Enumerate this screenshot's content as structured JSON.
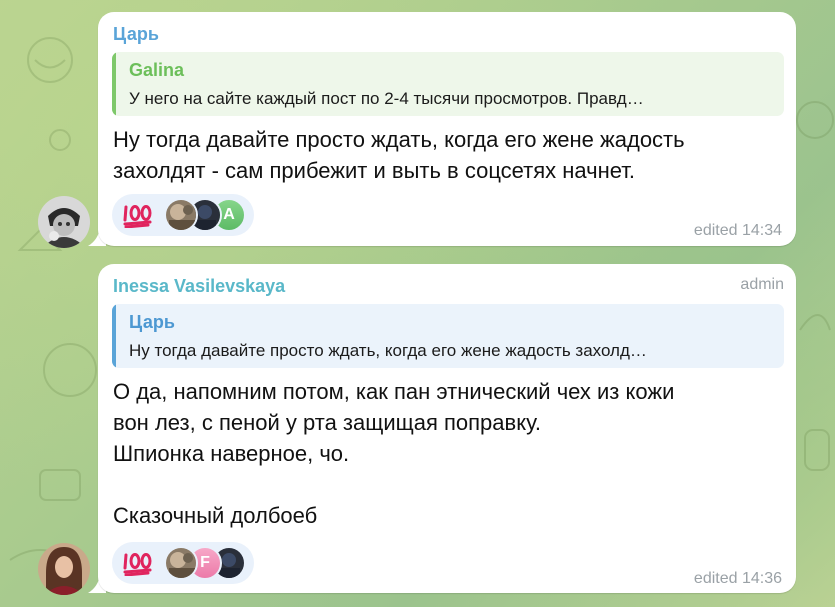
{
  "messages": [
    {
      "sender": "Царь",
      "sender_color": "#5aa4d8",
      "quote": {
        "author": "Galina",
        "text": "У него на сайте каждый пост по 2-4 тысячи просмотров. Правд…",
        "accent": "#7ec86a",
        "bg": "#eef7ea"
      },
      "lines": [
        "Ну тогда давайте просто ждать, когда его жене жадость",
        "захолдят - сам прибежит и выть в соцсетях начнет."
      ],
      "reactions": {
        "emoji": "💯",
        "emoji_icon": "hundred-points-icon",
        "avatars": [
          {
            "icon": "reactor-photo-1",
            "letter": ""
          },
          {
            "icon": "reactor-photo-2",
            "letter": ""
          },
          {
            "icon": "reactor-initial-a",
            "letter": "A"
          }
        ]
      },
      "edited": "edited 14:34"
    },
    {
      "sender": "Inessa Vasilevskaya",
      "sender_color": "#5ab8c9",
      "badge": "admin",
      "quote": {
        "author": "Царь",
        "text": "Ну тогда давайте просто ждать, когда его жене жадость захолд…",
        "accent": "#5aa4d8",
        "bg": "#ebf3fb"
      },
      "lines": [
        "О да, напомним потом, как пан этнический чех из кожи",
        "вон лез, с пеной у рта защищая поправку.",
        "Шпионка наверное, чо.",
        "",
        "Сказочный долбоеб"
      ],
      "reactions": {
        "emoji": "💯",
        "emoji_icon": "hundred-points-icon",
        "avatars": [
          {
            "icon": "reactor-photo-1",
            "letter": ""
          },
          {
            "icon": "reactor-initial-f",
            "letter": "F"
          },
          {
            "icon": "reactor-photo-2",
            "letter": ""
          }
        ]
      },
      "edited": "edited 14:36"
    }
  ]
}
